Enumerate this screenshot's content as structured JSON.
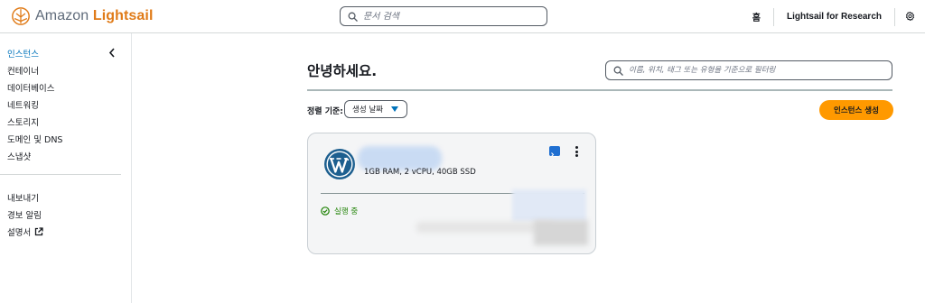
{
  "header": {
    "brand_prefix": "Amazon",
    "brand_accent": "Lightsail",
    "search_placeholder": "문서 검색",
    "links": [
      "홈",
      "Lightsail for Research"
    ]
  },
  "sidebar": {
    "items": [
      {
        "label": "인스턴스",
        "active": true
      },
      {
        "label": "컨테이너"
      },
      {
        "label": "데이터베이스"
      },
      {
        "label": "네트워킹"
      },
      {
        "label": "스토리지"
      },
      {
        "label": "도메인 및 DNS"
      },
      {
        "label": "스냅샷"
      }
    ],
    "secondary_items": [
      {
        "label": "내보내기"
      },
      {
        "label": "경보 알림"
      },
      {
        "label": "설명서"
      }
    ]
  },
  "main": {
    "greeting": "안녕하세요.",
    "filter_placeholder": "이름, 위치, 태그 또는 유형을 기준으로 필터링",
    "sort_label": "정렬 기준:",
    "sort_value": "생성 날짜",
    "create_button": "인스턴스 생성"
  },
  "instance": {
    "spec": "1GB RAM, 2 vCPU, 40GB SSD",
    "status": "실행 중"
  },
  "colors": {
    "accent": "#ff9900",
    "brand_orange": "#e07b18",
    "link_blue": "#0073bb",
    "running_green": "#1d8102"
  },
  "icons": [
    "lightsail-logo-icon",
    "search-icon",
    "gear-icon",
    "chevron-left-icon",
    "external-link-icon",
    "caret-down-icon",
    "wordpress-icon",
    "terminal-icon",
    "kebab-menu-icon",
    "check-circle-icon"
  ]
}
